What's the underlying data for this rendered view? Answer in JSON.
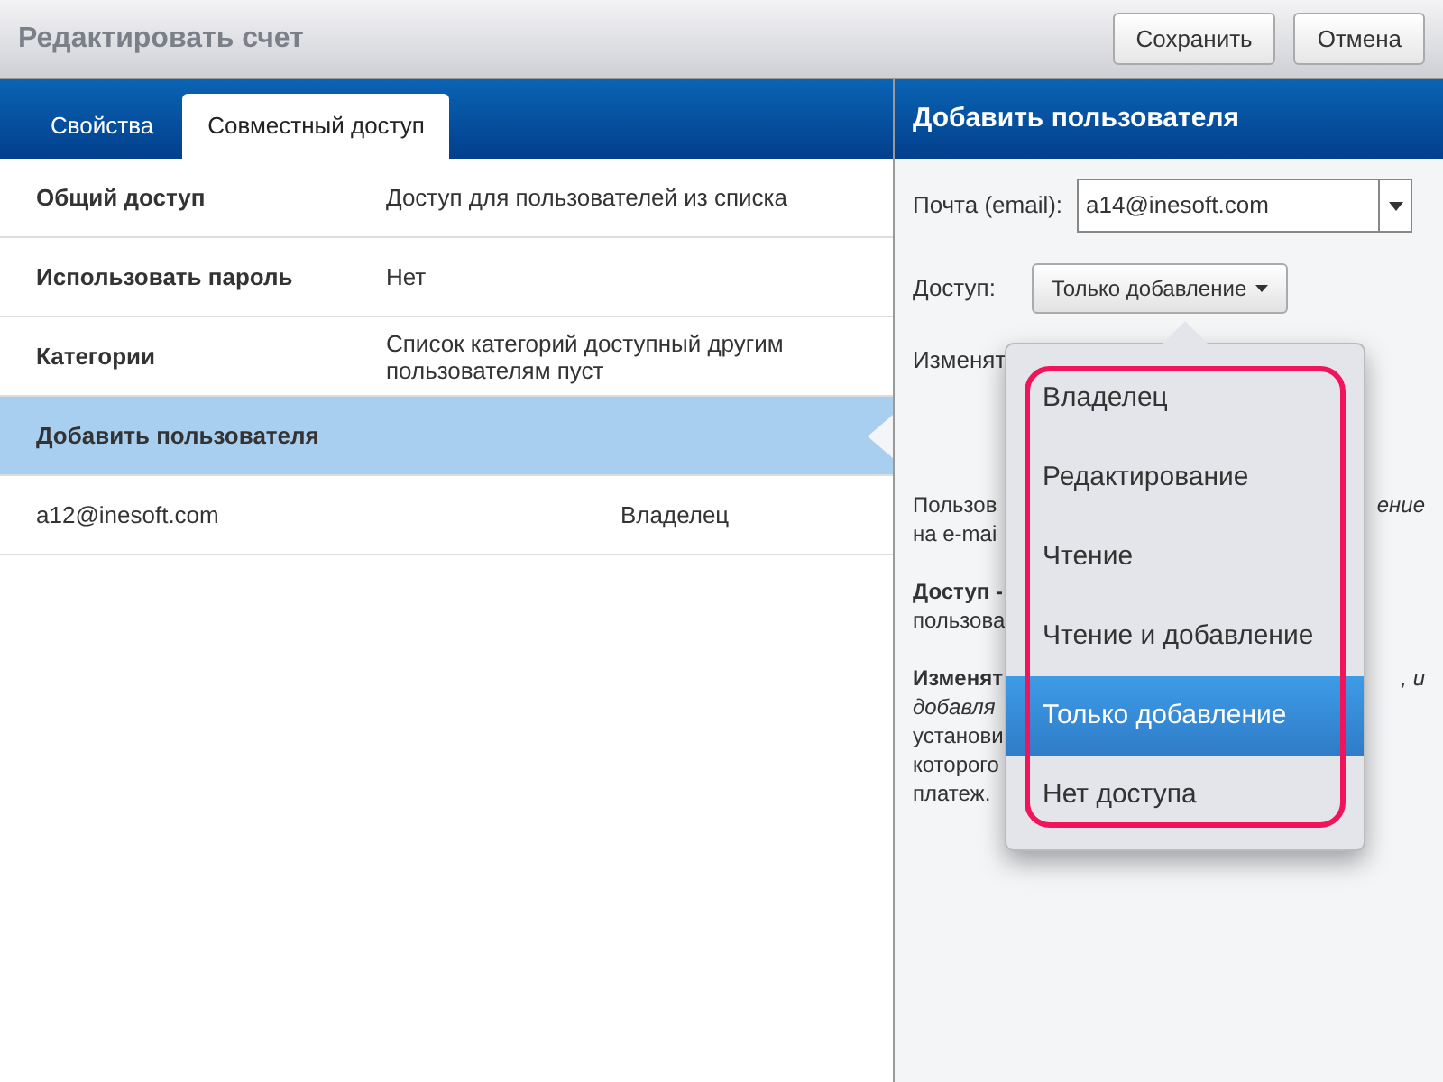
{
  "window": {
    "title": "Редактировать счет"
  },
  "buttons": [
    {
      "label": "Сохранить"
    },
    {
      "label": "Отмена"
    }
  ],
  "tabs": [
    {
      "label": "Свойства",
      "selected": false
    },
    {
      "label": "Совместный доступ",
      "selected": true
    }
  ],
  "settings": [
    {
      "label": "Общий доступ",
      "value": "Доступ для пользователей из списка",
      "selected": false
    },
    {
      "label": "Использовать пароль",
      "value": "Нет",
      "selected": false
    },
    {
      "label": "Категории",
      "value": "Список категорий доступный другим пользователям пуст",
      "selected": false
    },
    {
      "label": "Добавить пользователя",
      "selected": true
    }
  ],
  "users": [
    {
      "email": "a12@inesoft.com",
      "access": "Владелец"
    }
  ],
  "panel": {
    "title": "Добавить пользователя",
    "email_label": "Почта (email):",
    "email_value": "a14@inesoft.com",
    "access_label": "Доступ:",
    "access_value": "Только добавление",
    "change_label": "Изменят",
    "help_paragraphs": [
      {
        "lines": [
          {
            "kind": "plain",
            "left": "Пользов",
            "right": "ение"
          },
          {
            "kind": "plain",
            "left": "на e-mai"
          }
        ]
      },
      {
        "lines": [
          {
            "kind": "bold",
            "left": "Доступ -"
          },
          {
            "kind": "plain",
            "left": "пользова"
          }
        ]
      },
      {
        "lines": [
          {
            "kind": "bold",
            "left": "Изменят",
            "right": ", и"
          },
          {
            "kind": "italic",
            "left": "добавля"
          },
          {
            "kind": "plain",
            "left": "установи"
          },
          {
            "kind": "plain",
            "left": "которого"
          },
          {
            "kind": "plain",
            "left": "платеж."
          }
        ]
      }
    ]
  },
  "dropdown": {
    "items": [
      {
        "label": "Владелец",
        "selected": false
      },
      {
        "label": "Редактирование",
        "selected": false
      },
      {
        "label": "Чтение",
        "selected": false
      },
      {
        "label": "Чтение и добавление",
        "selected": false
      },
      {
        "label": "Только добавление",
        "selected": true
      },
      {
        "label": "Нет доступа",
        "selected": false
      }
    ]
  }
}
